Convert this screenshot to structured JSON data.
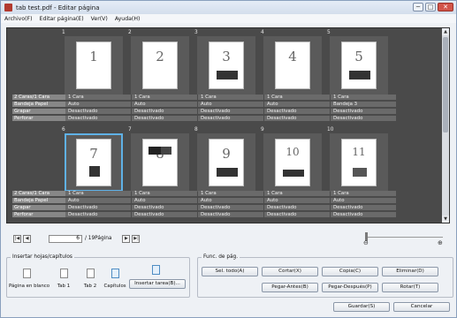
{
  "window": {
    "title": "tab test.pdf - Editar página",
    "minimize": "─",
    "maximize": "□",
    "close": "✕"
  },
  "menu": {
    "items": [
      "Archivo(F)",
      "Editar página(E)",
      "Ver(V)",
      "Ayuda(H)"
    ]
  },
  "attribute_labels": [
    "2 Caras/1 Cara",
    "Bandeja Papel",
    "Grapar",
    "Perforar"
  ],
  "rows": [
    {
      "pages": [
        {
          "number": "1",
          "duplex": "1 Cara",
          "tray": "Auto",
          "staple": "Desactivado",
          "punch": "Desactivado"
        },
        {
          "number": "2",
          "duplex": "1 Cara",
          "tray": "Auto",
          "staple": "Desactivado",
          "punch": "Desactivado"
        },
        {
          "number": "3",
          "duplex": "1 Cara",
          "tray": "Auto",
          "staple": "Desactivado",
          "punch": "Desactivado"
        },
        {
          "number": "4",
          "duplex": "1 Cara",
          "tray": "Auto",
          "staple": "Desactivado",
          "punch": "Desactivado"
        },
        {
          "number": "5",
          "duplex": "1 Cara",
          "tray": "Bandeja 3",
          "staple": "Desactivado",
          "punch": "Desactivado"
        }
      ]
    },
    {
      "pages": [
        {
          "number": "6",
          "duplex": "1 Cara",
          "tray": "Auto",
          "staple": "Desactivado",
          "punch": "Desactivado"
        },
        {
          "number": "7",
          "duplex": "1 Cara",
          "tray": "Auto",
          "staple": "Desactivado",
          "punch": "Desactivado"
        },
        {
          "number": "8",
          "duplex": "1 Cara",
          "tray": "Auto",
          "staple": "Desactivado",
          "punch": "Desactivado"
        },
        {
          "number": "9",
          "duplex": "1 Cara",
          "tray": "Auto",
          "staple": "Desactivado",
          "punch": "Desactivado"
        },
        {
          "number": "10",
          "duplex": "1 Cara",
          "tray": "Auto",
          "staple": "Desactivado",
          "punch": "Desactivado"
        }
      ]
    }
  ],
  "thumbnail_digits": [
    "1",
    "2",
    "3",
    "4",
    "5",
    "7",
    "8",
    "9",
    "10",
    "11"
  ],
  "selected_page": "6",
  "navigation": {
    "first": "|◀",
    "prev": "◀",
    "current_page": "6",
    "total": "/ 19Página",
    "next": "▶",
    "last": "▶|"
  },
  "zoom": {
    "minus_icon": "⊖",
    "plus_icon": "⊕"
  },
  "insert_group": {
    "title": "Insertar hojas/capítulos",
    "items": [
      "Página en blanco",
      "Tab 1",
      "Tab 2",
      "Capítulos"
    ],
    "insert_task_button": "Insertar tarea(B)..."
  },
  "functions_group": {
    "title": "Func. de pág.",
    "buttons": {
      "select_all": "Sel. todo(A)",
      "cut": "Cortar(X)",
      "copy": "Copia(C)",
      "delete": "Eliminar(D)",
      "paste_before": "Pegar-Antes(B)",
      "paste_after": "Pegar-Después(P)",
      "rotate": "Rotar(T)"
    }
  },
  "footer": {
    "save": "Guardar(S)",
    "cancel": "Cancelar"
  },
  "colors": {
    "selection_border": "#5fb1e6",
    "viewer_background": "#4a4a4a"
  }
}
